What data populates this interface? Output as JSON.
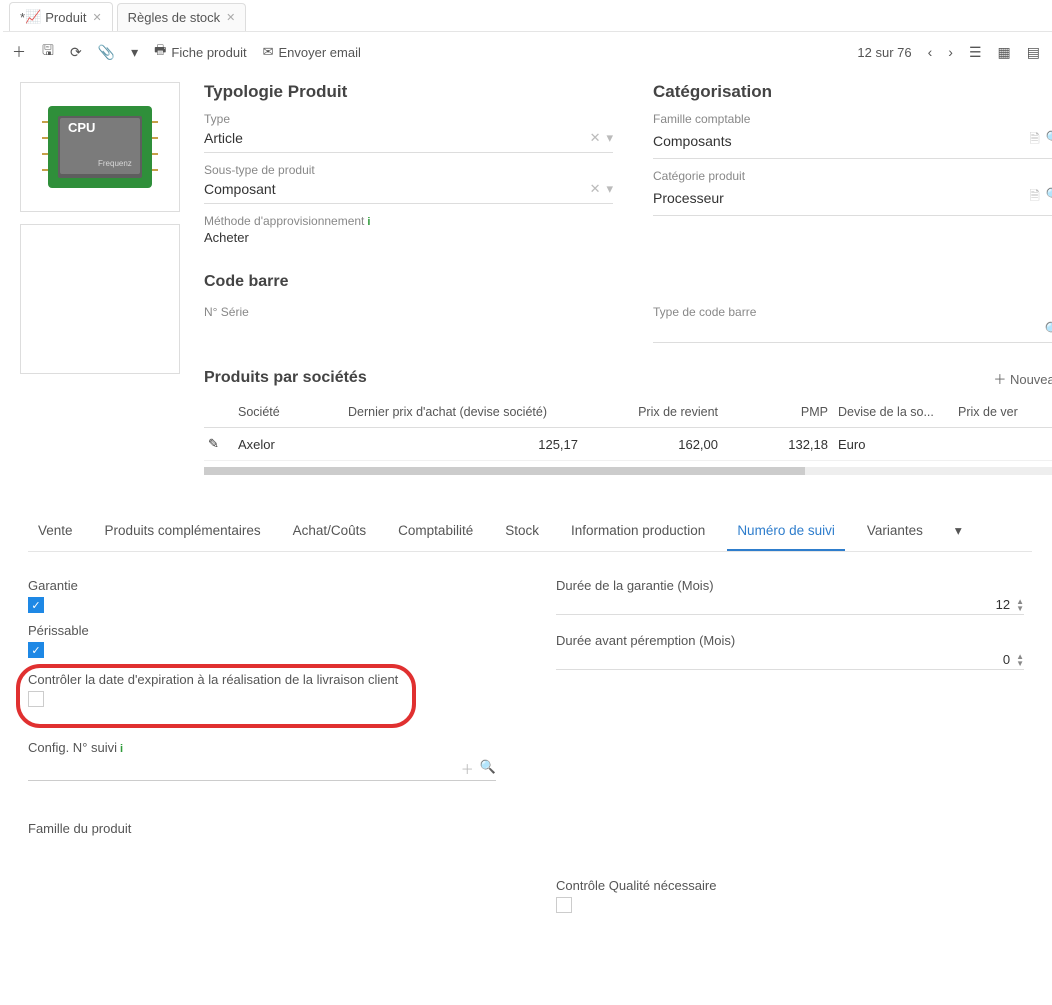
{
  "tabs": [
    {
      "label": "Produit",
      "active": true,
      "dirty": "*"
    },
    {
      "label": "Règles de stock",
      "active": false,
      "dirty": ""
    }
  ],
  "toolbar": {
    "fiche_label": "Fiche produit",
    "envoy_label": "Envoyer email",
    "counter": "12 sur 76"
  },
  "typologie": {
    "title": "Typologie Produit",
    "type_label": "Type",
    "type_value": "Article",
    "subtype_label": "Sous-type de produit",
    "subtype_value": "Composant",
    "method_label": "Méthode d'approvisionnement",
    "method_value": "Acheter"
  },
  "categorisation": {
    "title": "Catégorisation",
    "famille_label": "Famille comptable",
    "famille_value": "Composants",
    "categorie_label": "Catégorie produit",
    "categorie_value": "Processeur"
  },
  "codebarre": {
    "title": "Code barre",
    "serie_label": "N° Série",
    "type_label": "Type de code barre"
  },
  "produits_societes": {
    "title": "Produits par sociétés",
    "nouveau": "Nouveau",
    "cols": {
      "societe": "Société",
      "dernier": "Dernier prix d'achat (devise société)",
      "revient": "Prix de revient",
      "pmp": "PMP",
      "devise": "Devise de la so...",
      "prixver": "Prix de ver"
    },
    "rows": [
      {
        "societe": "Axelor",
        "dernier": "125,17",
        "revient": "162,00",
        "pmp": "132,18",
        "devise": "Euro",
        "prixver": ""
      }
    ]
  },
  "subtabs": [
    {
      "label": "Vente"
    },
    {
      "label": "Produits complémentaires"
    },
    {
      "label": "Achat/Coûts"
    },
    {
      "label": "Comptabilité"
    },
    {
      "label": "Stock"
    },
    {
      "label": "Information production"
    },
    {
      "label": "Numéro de suivi",
      "active": true
    },
    {
      "label": "Variantes"
    }
  ],
  "tracking": {
    "garantie_label": "Garantie",
    "perissable_label": "Périssable",
    "controler_label": "Contrôler la date d'expiration à la réalisation de la livraison client",
    "config_label": "Config. N° suivi",
    "famille_label": "Famille du produit",
    "duree_garantie_label": "Durée de la garantie (Mois)",
    "duree_garantie_value": "12",
    "duree_peremption_label": "Durée avant péremption (Mois)",
    "duree_peremption_value": "0",
    "qualite_label": "Contrôle Qualité nécessaire"
  }
}
